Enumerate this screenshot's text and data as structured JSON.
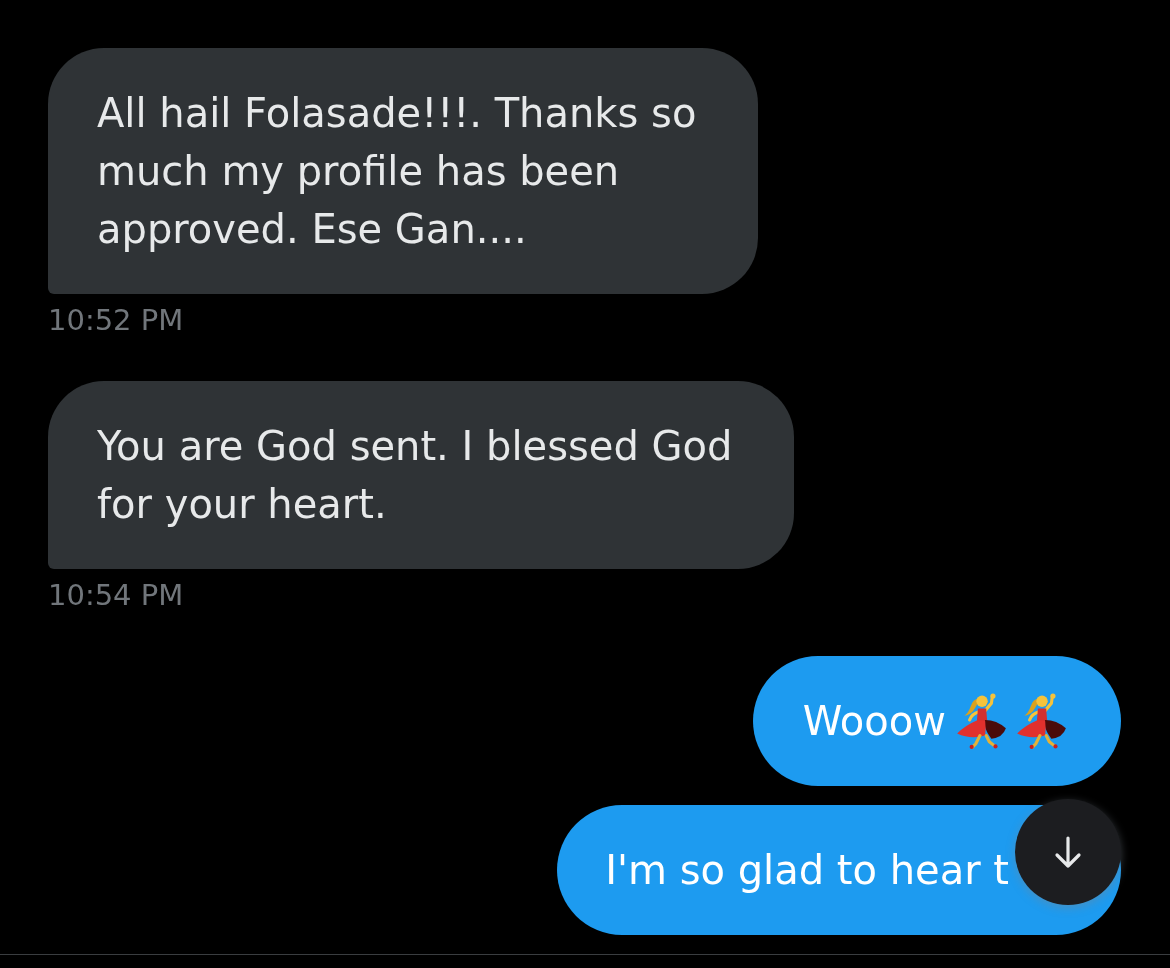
{
  "conversation": {
    "messages": [
      {
        "kind": "received",
        "text": "All hail Folasade!!!. Thanks so much my profile has been approved. Ese Gan....",
        "time": "10:52 PM"
      },
      {
        "kind": "received",
        "text": "You are God sent. I blessed God for your heart.",
        "time": "10:54 PM"
      },
      {
        "kind": "sent",
        "text": "Wooow",
        "emoji": [
          {
            "kind": "dancer"
          },
          {
            "kind": "dancer"
          }
        ]
      },
      {
        "kind": "sent",
        "text": "I'm so glad to hear t"
      }
    ]
  }
}
